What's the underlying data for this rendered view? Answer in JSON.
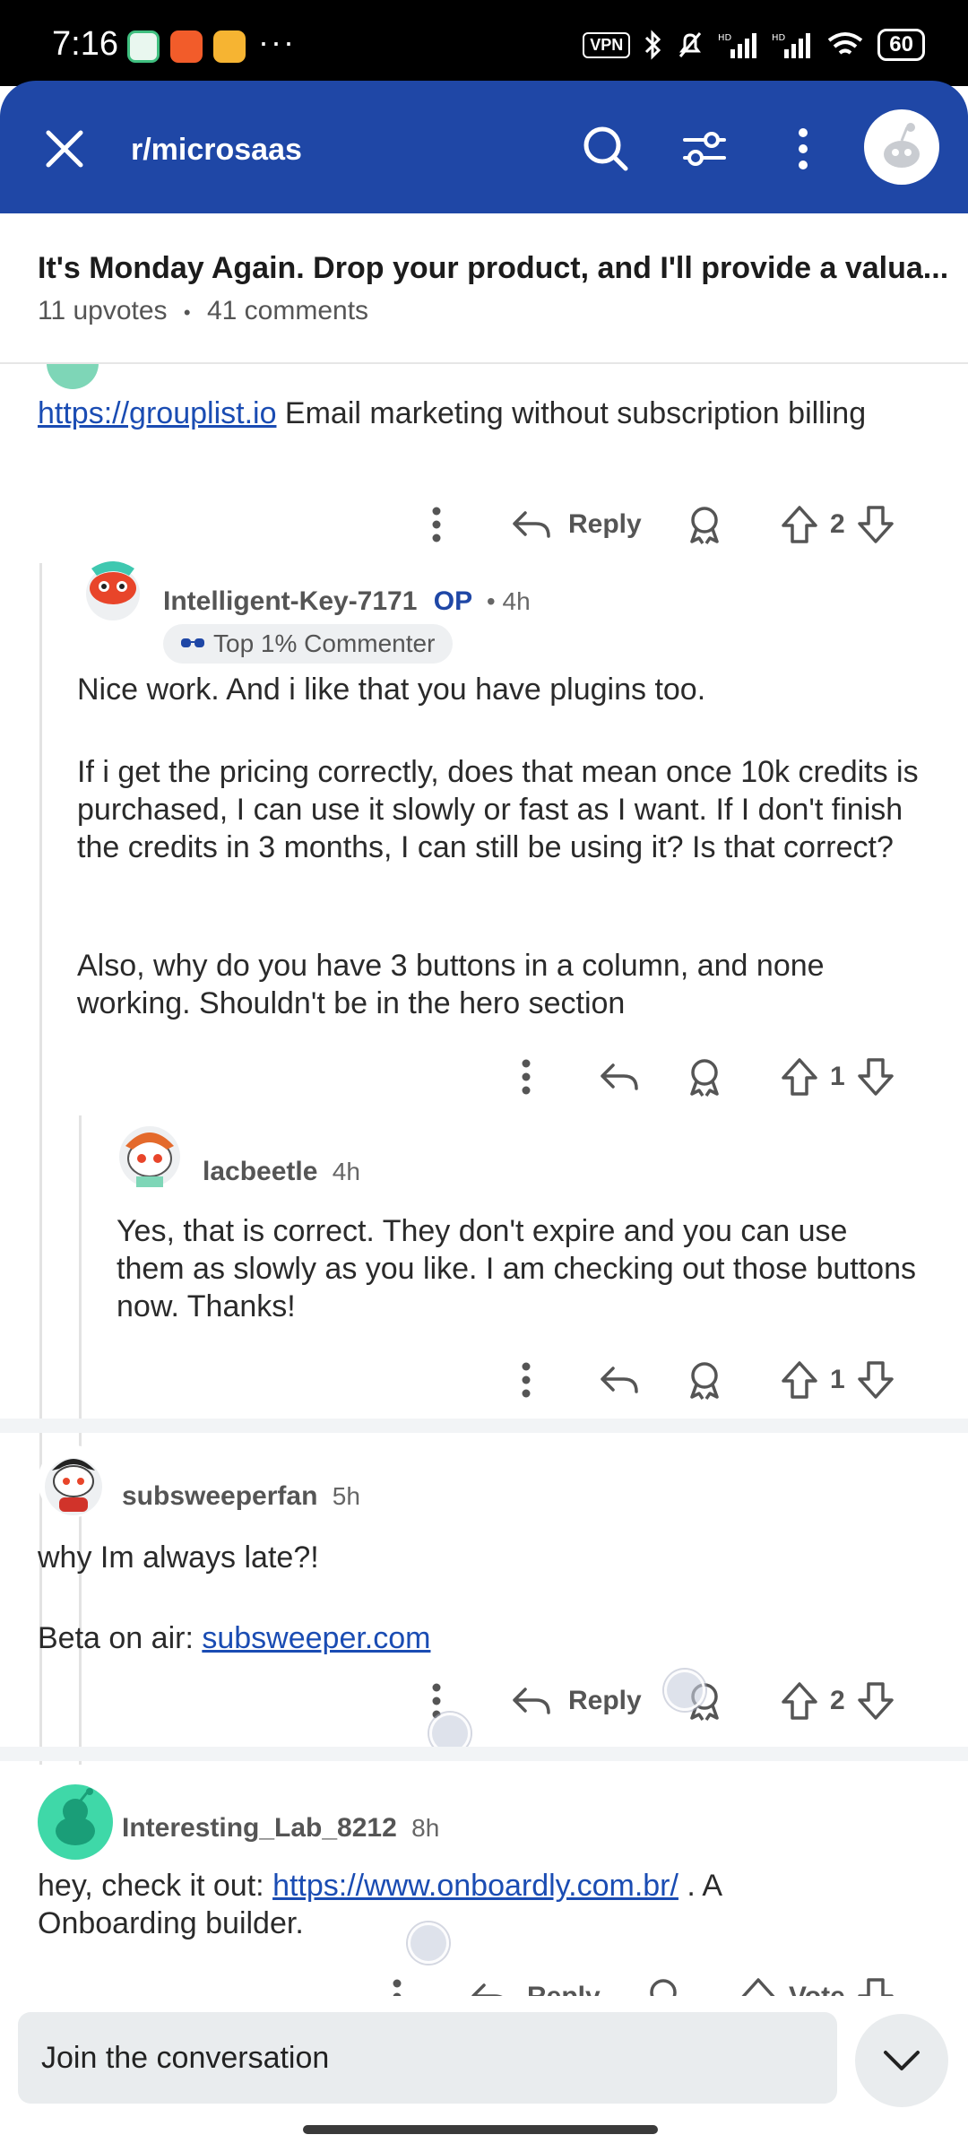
{
  "status_bar": {
    "time": "7:16",
    "vpn": "VPN",
    "battery": "60"
  },
  "header": {
    "title": "r/microsaas"
  },
  "post": {
    "title": "It's Monday Again. Drop your product, and I'll provide a valua...",
    "upvotes": "11 upvotes",
    "comments": "41 comments",
    "separator": "•"
  },
  "comments": [
    {
      "text_link": "https://grouplist.io",
      "text_rest": " Email marketing without subscription billing",
      "reply_label": "Reply",
      "votes": "2"
    },
    {
      "user": "Intelligent-Key-7171",
      "op": "OP",
      "time": "• 4h",
      "badge": "Top 1% Commenter",
      "para1": "Nice work. And i like that you have plugins too.",
      "para2": "If i get the pricing correctly, does that mean once 10k credits is purchased, I can use it slowly or fast as I want. If I don't finish the credits in 3 months, I can still be using it? Is that correct?",
      "para3": "Also, why do you have 3 buttons in a column, and none working. Shouldn't be in the hero section",
      "votes": "1"
    },
    {
      "user": "lacbeetle",
      "time": "4h",
      "text": "Yes, that is correct. They don't expire and you can use them as slowly as you like. I am checking out those buttons now. Thanks!",
      "votes": "1"
    },
    {
      "user": "subsweeperfan",
      "time": "5h",
      "para1": "why Im always late?!",
      "para2_prefix": "Beta on air: ",
      "para2_link": "subsweeper.com",
      "reply_label": "Reply",
      "votes": "2"
    },
    {
      "user": "Interesting_Lab_8212",
      "time": "8h",
      "text_prefix": "hey, check it out: ",
      "text_link": "https://www.onboardly.com.br/",
      "text_rest": " . A Onboarding builder.",
      "reply_label": "Reply",
      "vote_label": "Vote"
    }
  ],
  "composer": {
    "placeholder": "Join the conversation"
  },
  "colors": {
    "header_bg": "#1f47a6",
    "link": "#1a4cb3",
    "op": "#1f47a6"
  }
}
